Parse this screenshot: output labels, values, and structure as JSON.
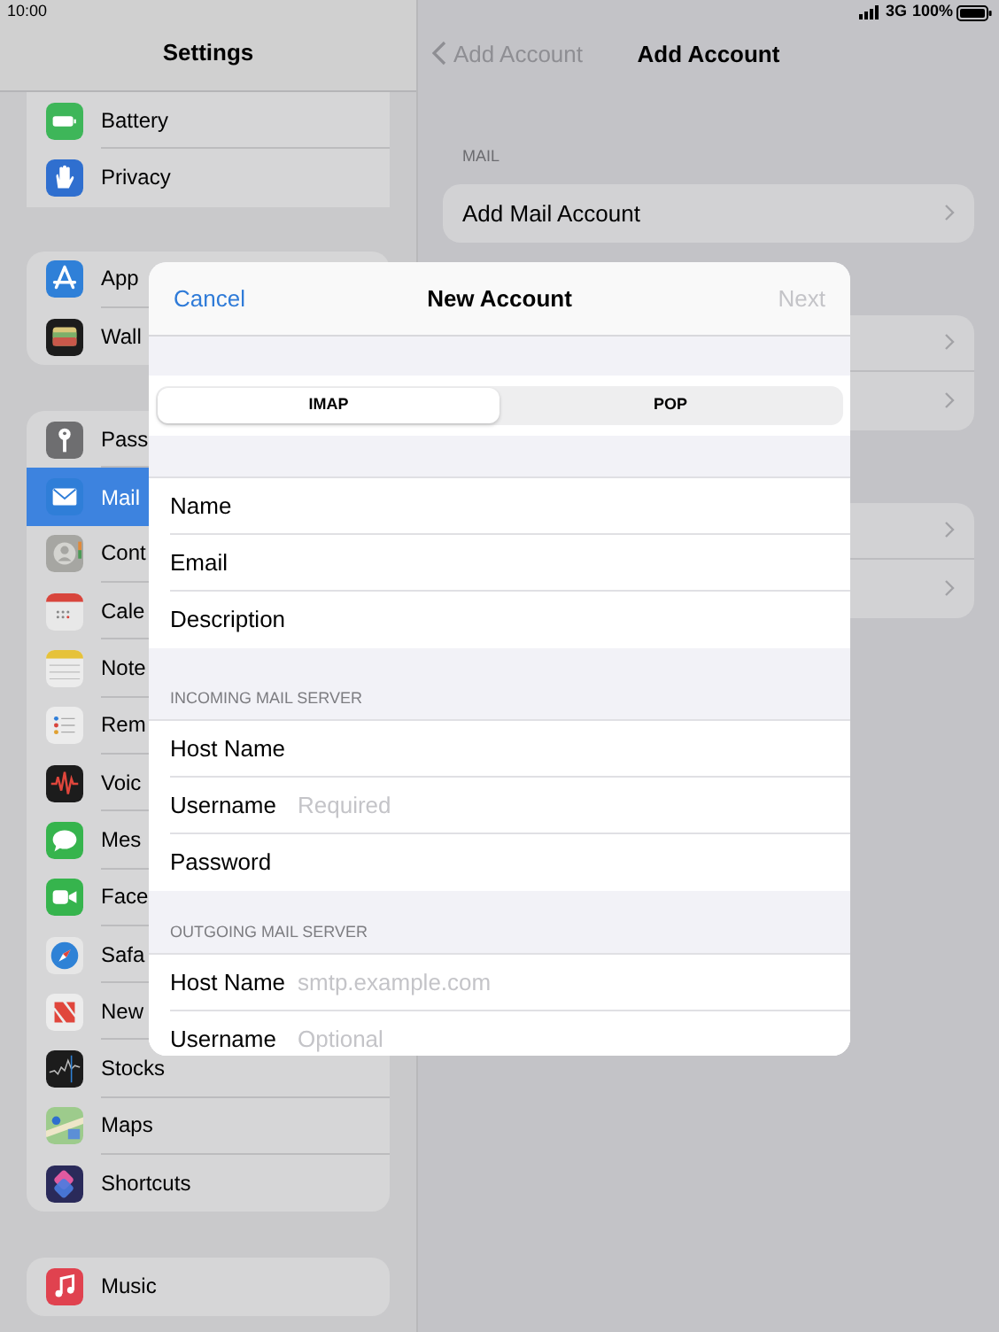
{
  "status_bar": {
    "time": "10:00",
    "network": "3G",
    "battery": "100%"
  },
  "sidebar": {
    "title": "Settings",
    "groups": [
      {
        "items": [
          {
            "label": "Battery",
            "selected": false
          },
          {
            "label": "Privacy",
            "selected": false
          }
        ]
      },
      {
        "items": [
          {
            "label": "App",
            "selected": false
          },
          {
            "label": "Wall",
            "selected": false
          }
        ]
      },
      {
        "items": [
          {
            "label": "Pass",
            "selected": false
          },
          {
            "label": "Mail",
            "selected": true
          },
          {
            "label": "Cont",
            "selected": false
          },
          {
            "label": "Cale",
            "selected": false
          },
          {
            "label": "Note",
            "selected": false
          },
          {
            "label": "Rem",
            "selected": false
          },
          {
            "label": "Voic",
            "selected": false
          },
          {
            "label": "Mes",
            "selected": false
          },
          {
            "label": "Face",
            "selected": false
          },
          {
            "label": "Safa",
            "selected": false
          },
          {
            "label": "New",
            "selected": false
          },
          {
            "label": "Stocks",
            "selected": false
          },
          {
            "label": "Maps",
            "selected": false
          },
          {
            "label": "Shortcuts",
            "selected": false
          }
        ]
      },
      {
        "items": [
          {
            "label": "Music",
            "selected": false
          }
        ]
      }
    ]
  },
  "detail": {
    "back": "Add Account",
    "title": "Add Account",
    "sections": [
      {
        "header": "MAIL",
        "rows": [
          {
            "kind": "link",
            "label": "Add Mail Account"
          }
        ]
      },
      {
        "rows": [
          {
            "kind": "covered"
          },
          {
            "kind": "covered"
          }
        ]
      },
      {
        "rows": [
          {
            "kind": "covered"
          },
          {
            "kind": "covered"
          }
        ]
      }
    ]
  },
  "modal": {
    "cancel": "Cancel",
    "title": "New Account",
    "next": "Next",
    "next_disabled": true,
    "segments": [
      {
        "label": "IMAP",
        "selected": true
      },
      {
        "label": "POP",
        "selected": false
      }
    ],
    "sections": [
      {
        "fields": [
          {
            "label": "Name"
          },
          {
            "label": "Email"
          },
          {
            "label": "Description"
          }
        ]
      },
      {
        "header": "INCOMING MAIL SERVER",
        "fields": [
          {
            "label": "Host Name"
          },
          {
            "label": "Username",
            "placeholder": "Required"
          },
          {
            "label": "Password"
          }
        ]
      },
      {
        "header": "OUTGOING MAIL SERVER",
        "fields": [
          {
            "label": "Host Name",
            "placeholder": "smtp.example.com"
          },
          {
            "label": "Username",
            "placeholder": "Optional"
          }
        ]
      }
    ]
  }
}
